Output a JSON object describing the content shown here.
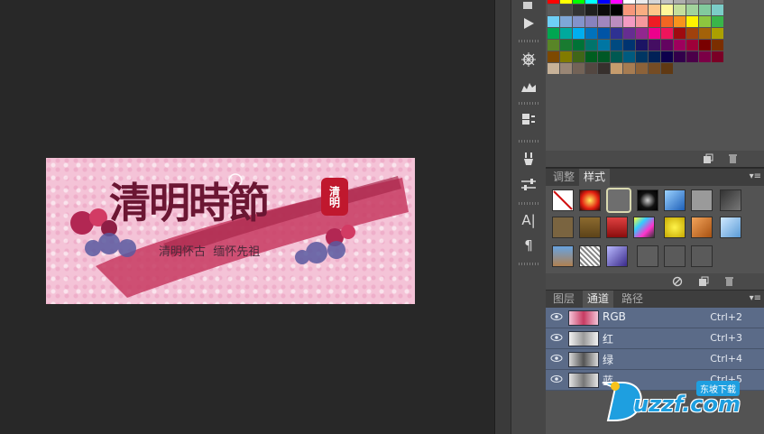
{
  "document": {
    "title_art": "清明時節",
    "seal_text": "清明",
    "subtitle": "清明怀古  缅怀先祖"
  },
  "colors": {
    "artboard_pink": "#f4c3d7",
    "brush_red": "#c73b62",
    "title_ink": "#6b1633",
    "seal_red": "#c0182e",
    "selection_blue": "#5b6b88",
    "panel_gray": "#535353"
  },
  "toolstrip": {
    "tools": [
      "play-icon",
      "compass-icon",
      "histogram-icon",
      "layer-comps-icon",
      "brush-icon",
      "adjust-sliders-icon",
      "character-icon",
      "paragraph-icon"
    ],
    "character_glyph": "A|",
    "paragraph_glyph": "¶"
  },
  "swatches": {
    "footer_icons": [
      "new-swatch-icon",
      "trash-icon"
    ]
  },
  "styles_panel": {
    "tabs": [
      "调整",
      "样式"
    ],
    "active_tab": "样式",
    "footer_icons": [
      "clear-style-icon",
      "new-style-icon",
      "trash-icon"
    ]
  },
  "channels_panel": {
    "tabs": [
      "图层",
      "通道",
      "路径"
    ],
    "active_tab": "通道",
    "rows": [
      {
        "name": "RGB",
        "shortcut": "Ctrl+2"
      },
      {
        "name": "红",
        "shortcut": "Ctrl+3"
      },
      {
        "name": "绿",
        "shortcut": "Ctrl+4"
      },
      {
        "name": "蓝",
        "shortcut": "Ctrl+5"
      }
    ]
  },
  "watermark": {
    "text": "uzzf.com",
    "badge": "东坡下载"
  }
}
